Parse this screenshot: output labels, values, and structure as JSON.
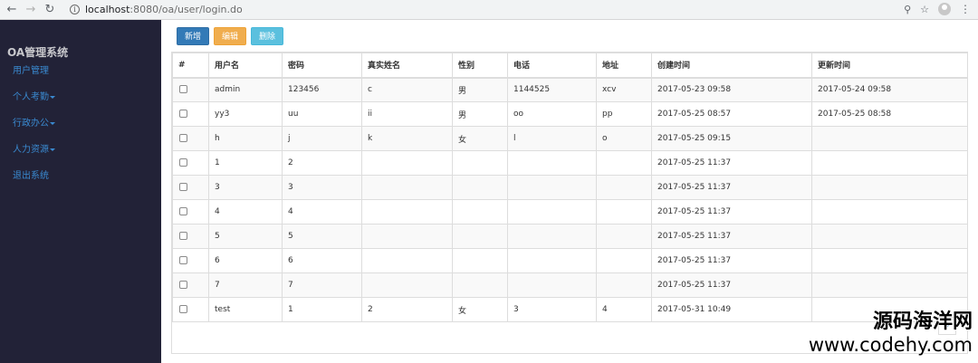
{
  "browser": {
    "back_icon": "arrow-left-icon",
    "forward_icon": "arrow-right-icon",
    "reload_icon": "reload-icon",
    "url_host": "localhost",
    "url_path": ":8080/oa/user/login.do"
  },
  "sidebar": {
    "brand": "OA管理系统",
    "items": [
      {
        "label": "用户管理",
        "has_caret": false
      },
      {
        "label": "个人考勤",
        "has_caret": true
      },
      {
        "label": "行政办公",
        "has_caret": true
      },
      {
        "label": "人力资源",
        "has_caret": true
      },
      {
        "label": "退出系统",
        "has_caret": false
      }
    ]
  },
  "toolbar": {
    "add_label": "新增",
    "edit_label": "编辑",
    "delete_label": "删除"
  },
  "table": {
    "headers": [
      "#",
      "用户名",
      "密码",
      "真实姓名",
      "性别",
      "电话",
      "地址",
      "创建时间",
      "更新时间"
    ],
    "rows": [
      [
        "admin",
        "123456",
        "c",
        "男",
        "1144525",
        "xcv",
        "2017-05-23 09:58",
        "2017-05-24 09:58"
      ],
      [
        "yy3",
        "uu",
        "ii",
        "男",
        "oo",
        "pp",
        "2017-05-25 08:57",
        "2017-05-25 08:58"
      ],
      [
        "h",
        "j",
        "k",
        "女",
        "l",
        "o",
        "2017-05-25 09:15",
        ""
      ],
      [
        "1",
        "2",
        "",
        "",
        "",
        "",
        "2017-05-25 11:37",
        ""
      ],
      [
        "3",
        "3",
        "",
        "",
        "",
        "",
        "2017-05-25 11:37",
        ""
      ],
      [
        "4",
        "4",
        "",
        "",
        "",
        "",
        "2017-05-25 11:37",
        ""
      ],
      [
        "5",
        "5",
        "",
        "",
        "",
        "",
        "2017-05-25 11:37",
        ""
      ],
      [
        "6",
        "6",
        "",
        "",
        "",
        "",
        "2017-05-25 11:37",
        ""
      ],
      [
        "7",
        "7",
        "",
        "",
        "",
        "",
        "2017-05-25 11:37",
        ""
      ],
      [
        "test",
        "1",
        "2",
        "女",
        "3",
        "4",
        "2017-05-31 10:49",
        ""
      ]
    ]
  },
  "pager": {
    "next_label": "»"
  },
  "watermark": {
    "title": "源码海洋网",
    "url": "www.codehy.com"
  },
  "colors": {
    "sidebar_bg": "#222237",
    "menu_link": "#3a8ad1",
    "btn_add": "#337ab7",
    "btn_edit": "#f0ad4e",
    "btn_delete": "#5bc0de"
  }
}
